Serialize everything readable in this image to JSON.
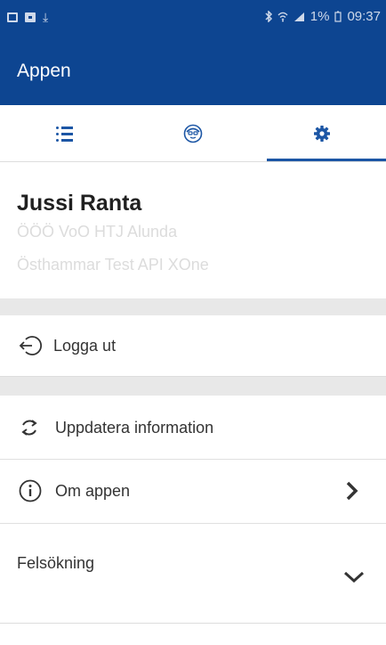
{
  "status_bar": {
    "battery": "1%",
    "time": "09:37",
    "download_glyph": "⤓"
  },
  "app_bar": {
    "title": "Appen"
  },
  "tabs": [
    {
      "name": "list",
      "icon": "list-icon",
      "active": false
    },
    {
      "name": "profile",
      "icon": "avatar-icon",
      "active": false
    },
    {
      "name": "settings",
      "icon": "gear-icon",
      "active": true
    }
  ],
  "profile": {
    "name": "Jussi Ranta",
    "line1": "ÖÖÖ VoO HTJ Alunda",
    "line2": "Östhammar Test API XOne"
  },
  "menu": {
    "logout": {
      "label": "Logga ut",
      "icon": "logout-icon"
    },
    "update": {
      "label": "Uppdatera information",
      "icon": "refresh-icon"
    },
    "about": {
      "label": "Om appen",
      "icon": "info-icon"
    },
    "debug": {
      "label": "Felsökning",
      "icon": "chevron-down-icon"
    }
  },
  "colors": {
    "primary": "#0d4591",
    "accent": "#1c56a5",
    "divider": "#e8e8e8",
    "muted_text": "#dcdcdc"
  }
}
